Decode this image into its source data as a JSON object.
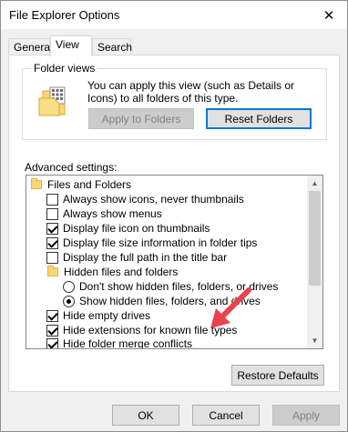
{
  "window": {
    "title": "File Explorer Options",
    "close_glyph": "✕"
  },
  "tabs": [
    {
      "label": "General",
      "selected": false
    },
    {
      "label": "View",
      "selected": true
    },
    {
      "label": "Search",
      "selected": false
    }
  ],
  "folder_views": {
    "legend": "Folder views",
    "description": "You can apply this view (such as Details or Icons) to all folders of this type.",
    "apply_button": "Apply to Folders",
    "apply_enabled": false,
    "reset_button": "Reset Folders"
  },
  "advanced": {
    "label": "Advanced settings:",
    "items": [
      {
        "type": "folder",
        "label": "Files and Folders",
        "indent": 0
      },
      {
        "type": "checkbox",
        "label": "Always show icons, never thumbnails",
        "checked": false,
        "indent": 1
      },
      {
        "type": "checkbox",
        "label": "Always show menus",
        "checked": false,
        "indent": 1
      },
      {
        "type": "checkbox",
        "label": "Display file icon on thumbnails",
        "checked": true,
        "indent": 1
      },
      {
        "type": "checkbox",
        "label": "Display file size information in folder tips",
        "checked": true,
        "indent": 1
      },
      {
        "type": "checkbox",
        "label": "Display the full path in the title bar",
        "checked": false,
        "indent": 1
      },
      {
        "type": "folder",
        "label": "Hidden files and folders",
        "indent": 1
      },
      {
        "type": "radio",
        "label": "Don't show hidden files, folders, or drives",
        "checked": false,
        "indent": 2
      },
      {
        "type": "radio",
        "label": "Show hidden files, folders, and drives",
        "checked": true,
        "indent": 2
      },
      {
        "type": "checkbox",
        "label": "Hide empty drives",
        "checked": true,
        "indent": 1
      },
      {
        "type": "checkbox",
        "label": "Hide extensions for known file types",
        "checked": true,
        "indent": 1
      },
      {
        "type": "checkbox",
        "label": "Hide folder merge conflicts",
        "checked": true,
        "indent": 1
      }
    ]
  },
  "buttons": {
    "restore_defaults": "Restore Defaults",
    "ok": "OK",
    "cancel": "Cancel",
    "apply": "Apply",
    "apply_enabled": false
  },
  "colors": {
    "accent": "#0078d7",
    "annotation_arrow": "#e8434f",
    "folder_yellow": "#f7d676"
  },
  "icons": {
    "folder_views": "folder-views-icon",
    "tree_folder": "folder-icon",
    "scroll_up": "chevron-up-icon",
    "scroll_down": "chevron-down-icon",
    "close": "close-icon"
  }
}
